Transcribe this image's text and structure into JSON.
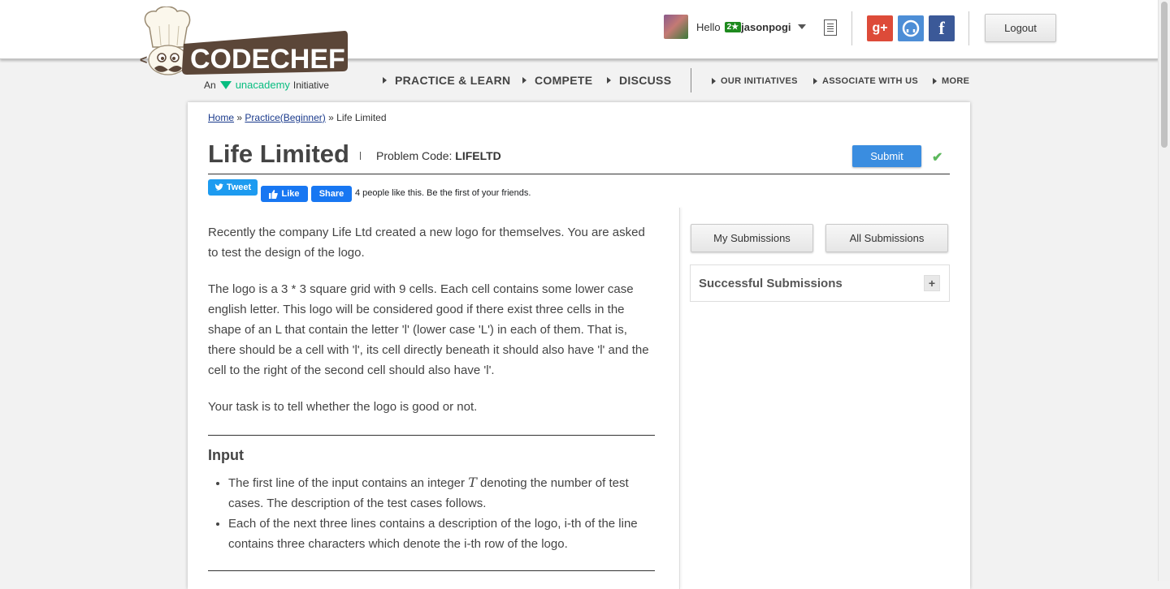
{
  "header": {
    "logo_text": "CODECHEF",
    "logo_sub_prefix": "An",
    "logo_sub_brand": "unacademy",
    "logo_sub_suffix": "Initiative",
    "hello": "Hello",
    "user_badge": "2★",
    "username": "jasonpogi",
    "logout": "Logout"
  },
  "nav": {
    "practice": "PRACTICE & LEARN",
    "compete": "COMPETE",
    "discuss": "DISCUSS",
    "initiatives": "OUR INITIATIVES",
    "associate": "ASSOCIATE WITH US",
    "more": "MORE"
  },
  "breadcrumb": {
    "home": "Home",
    "sep1": "»",
    "practice": "Practice(Beginner)",
    "sep2": "»",
    "current": "Life Limited"
  },
  "problem": {
    "title": "Life Limited",
    "code_label": "Problem Code:",
    "code": "LIFELTD",
    "submit": "Submit",
    "check": "✔"
  },
  "social": {
    "tweet": "Tweet",
    "like": "Like",
    "share": "Share",
    "like_text": "4 people like this. Be the first of your friends."
  },
  "statement": {
    "p1": "Recently the company Life Ltd created a new logo for themselves. You are asked to test the design of the logo.",
    "p2": "The logo is a 3 * 3 square grid with 9 cells. Each cell contains some lower case english letter. This logo will be considered good if there exist three cells in the shape of an L that contain the letter 'l' (lower case 'L') in each of them. That is, there should be a cell with 'l', its cell directly beneath it should also have 'l' and the cell to the right of the second cell should also have 'l'.",
    "p3": "Your task is to tell whether the logo is good or not.",
    "input_heading": "Input",
    "input_li1_a": "The first line of the input contains an integer",
    "input_li1_var": "T",
    "input_li1_b": "denoting the number of test cases. The description of the test cases follows.",
    "input_li2": "Each of the next three lines contains a description of the logo, i-th of the line contains three characters which denote the i-th row of the logo."
  },
  "sidebar": {
    "my_submissions": "My Submissions",
    "all_submissions": "All Submissions",
    "successful": "Successful Submissions",
    "expand": "+"
  },
  "colors": {
    "submit_blue": "#3a8de0",
    "codechef_brown": "#5b4638",
    "google_red": "#dd4b39",
    "github_blue": "#4d8ed6",
    "facebook_blue": "#3b5998"
  }
}
